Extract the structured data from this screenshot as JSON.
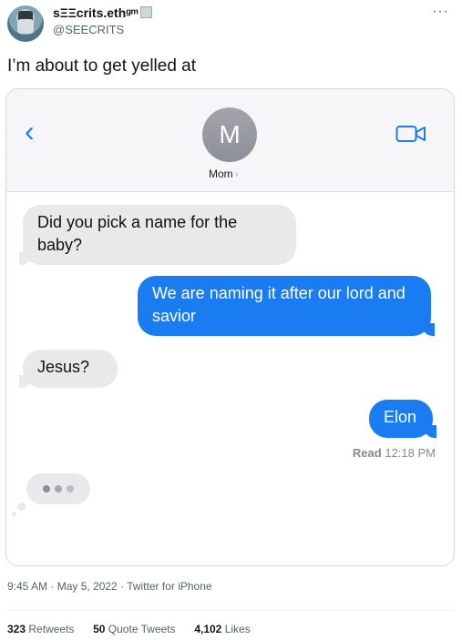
{
  "author": {
    "display_name": "sΞΞcrits.ethᵍᵐ",
    "handle": "@SEECRITS",
    "more_label": "···"
  },
  "tweet": {
    "text": "I’m about to get yelled at",
    "timestamp": "9:45 AM · May 5, 2022 · Twitter for iPhone",
    "retweets_count": "323",
    "retweets_label": "Retweets",
    "quotes_count": "50",
    "quotes_label": "Quote Tweets",
    "likes_count": "4,102",
    "likes_label": "Likes"
  },
  "chat": {
    "back_icon": "‹",
    "contact_initial": "M",
    "contact_name": "Mom",
    "contact_chevron": "›",
    "messages": [
      {
        "from": "them",
        "text": "Did you pick a name for the baby?"
      },
      {
        "from": "me",
        "text": "We are naming it after our lord and savior"
      },
      {
        "from": "them",
        "text": "Jesus?"
      },
      {
        "from": "me",
        "text": "Elon"
      }
    ],
    "read_label": "Read",
    "read_time": "12:18 PM"
  },
  "colors": {
    "sent_bubble": "#1a7cf1",
    "received_bubble": "#e9e9eb",
    "icon_accent": "#1a7cf1"
  },
  "icons": [
    "avatar",
    "more-icon",
    "back-chevron-icon",
    "video-call-icon",
    "typing-indicator-icon"
  ]
}
